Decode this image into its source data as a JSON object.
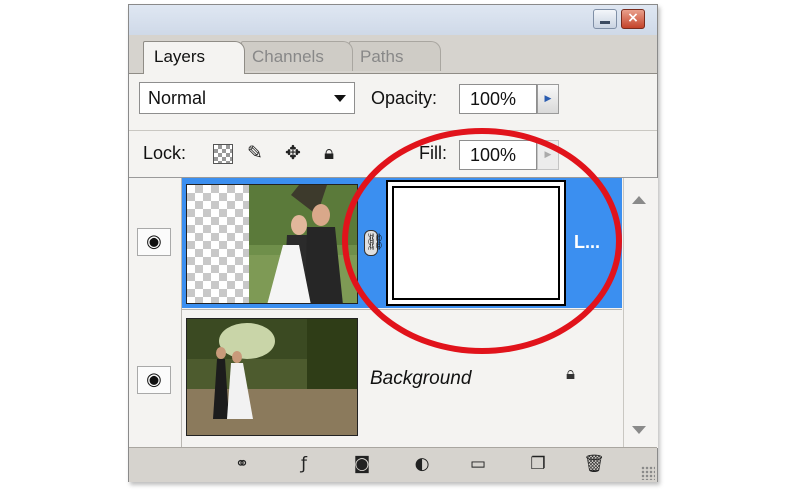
{
  "tabs": [
    {
      "label": "Layers",
      "active": true
    },
    {
      "label": "Channels",
      "active": false
    },
    {
      "label": "Paths",
      "active": false
    }
  ],
  "blend_mode": {
    "selected": "Normal"
  },
  "opacity": {
    "label": "Opacity:",
    "value": "100%"
  },
  "fill": {
    "label": "Fill:",
    "value": "100%"
  },
  "lock": {
    "label": "Lock:",
    "icons": [
      "lock-transparent-icon",
      "lock-paint-icon",
      "lock-move-icon",
      "lock-all-icon"
    ]
  },
  "layers": [
    {
      "name": "L...",
      "selected": true,
      "visible": true,
      "has_mask": true
    },
    {
      "name": "Background",
      "selected": false,
      "visible": true,
      "locked": true
    }
  ],
  "bottom_icons": [
    "link-layers-icon",
    "layer-style-icon",
    "add-mask-icon",
    "adjustment-layer-icon",
    "new-group-icon",
    "new-layer-icon",
    "trash-icon"
  ],
  "colors": {
    "selection": "#3b8ff0",
    "annotation": "#e1131b",
    "panel": "#d6d3ce"
  }
}
